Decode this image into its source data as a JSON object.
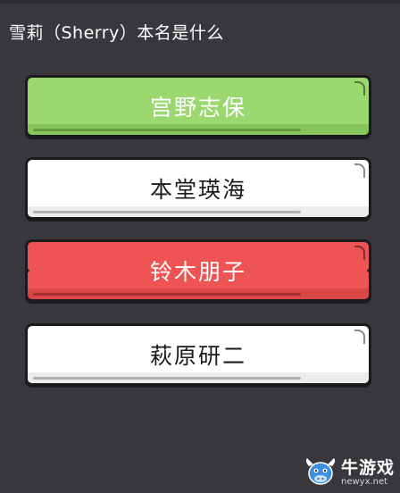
{
  "question": {
    "text": "雪莉（Sherry）本名是什么"
  },
  "options": [
    {
      "label": "宫野志保",
      "state": "correct",
      "color": "#9bd870"
    },
    {
      "label": "本堂瑛海",
      "state": "neutral",
      "color": "#ffffff"
    },
    {
      "label": "铃木朋子",
      "state": "wrong",
      "color": "#ee5454"
    },
    {
      "label": "萩原研二",
      "state": "neutral",
      "color": "#ffffff"
    }
  ],
  "watermark": {
    "name": "牛游戏",
    "url": "newyx.net",
    "icon": "bull-mascot-icon"
  },
  "colors": {
    "background": "#3a373c",
    "correct": "#9bd870",
    "wrong": "#ee5454"
  }
}
